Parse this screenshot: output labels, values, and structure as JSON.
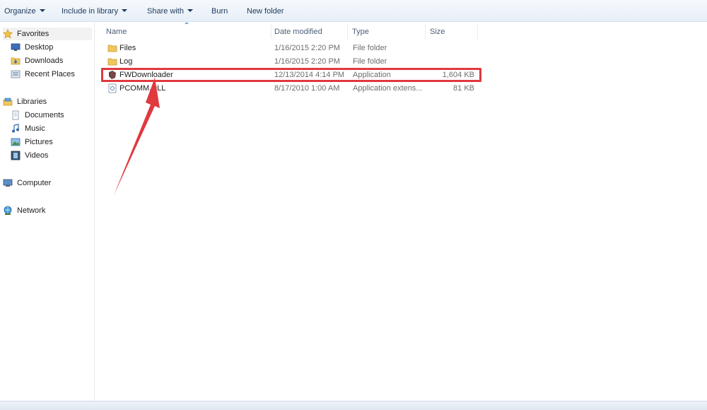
{
  "toolbar": {
    "organize": "Organize",
    "include_in_library": "Include in library",
    "share_with": "Share with",
    "burn": "Burn",
    "new_folder": "New folder"
  },
  "nav": {
    "favorites": "Favorites",
    "desktop": "Desktop",
    "downloads": "Downloads",
    "recent_places": "Recent Places",
    "libraries": "Libraries",
    "documents": "Documents",
    "music": "Music",
    "pictures": "Pictures",
    "videos": "Videos",
    "computer": "Computer",
    "network": "Network"
  },
  "columns": {
    "name": "Name",
    "date_modified": "Date modified",
    "type": "Type",
    "size": "Size"
  },
  "files": [
    {
      "name": "Files",
      "date": "1/16/2015 2:20 PM",
      "type": "File folder",
      "size": "",
      "icon": "folder-icon"
    },
    {
      "name": "Log",
      "date": "1/16/2015 2:20 PM",
      "type": "File folder",
      "size": "",
      "icon": "folder-icon"
    },
    {
      "name": "FWDownloader",
      "date": "12/13/2014 4:14 PM",
      "type": "Application",
      "size": "1,604 KB",
      "icon": "application-icon"
    },
    {
      "name": "PCOMM.DLL",
      "date": "8/17/2010 1:00 AM",
      "type": "Application extens...",
      "size": "81 KB",
      "icon": "dll-icon"
    }
  ],
  "colors": {
    "highlight": "#e0393e",
    "arrow": "#e0393e"
  }
}
